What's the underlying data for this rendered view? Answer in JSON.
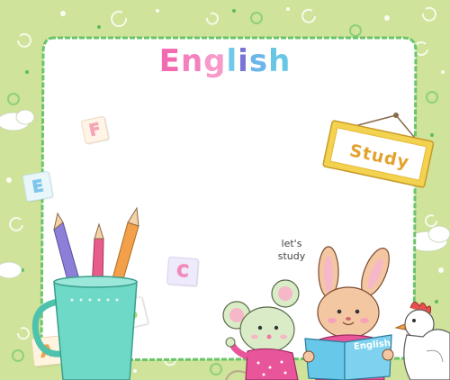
{
  "title": {
    "letters": [
      {
        "ch": "E",
        "color": "#f26ab0"
      },
      {
        "ch": "n",
        "color": "#f580be"
      },
      {
        "ch": "g",
        "color": "#f79ac9"
      },
      {
        "ch": "l",
        "color": "#6fc9e9"
      },
      {
        "ch": "i",
        "color": "#7a74d6"
      },
      {
        "ch": "s",
        "color": "#6ab6e8"
      },
      {
        "ch": "h",
        "color": "#67c6e3"
      }
    ]
  },
  "sign": {
    "text": "Study"
  },
  "speech": {
    "line1": "let's",
    "line2": "study"
  },
  "book": {
    "label": "English"
  },
  "blocks": [
    {
      "letter": "F",
      "color": "#f4a6b6"
    },
    {
      "letter": "E",
      "color": "#7fc6ec"
    },
    {
      "letter": "C",
      "color": "#f08ab8"
    },
    {
      "letter": "B",
      "color": "#a8d86d"
    },
    {
      "letter": "A",
      "color": "#f2a24b"
    }
  ],
  "colors": {
    "background": "#cfe39a",
    "board": "#ffffff",
    "board_border": "#6ac46a",
    "cup": "#6ed9c7",
    "sign_frame": "#f3d24f"
  }
}
